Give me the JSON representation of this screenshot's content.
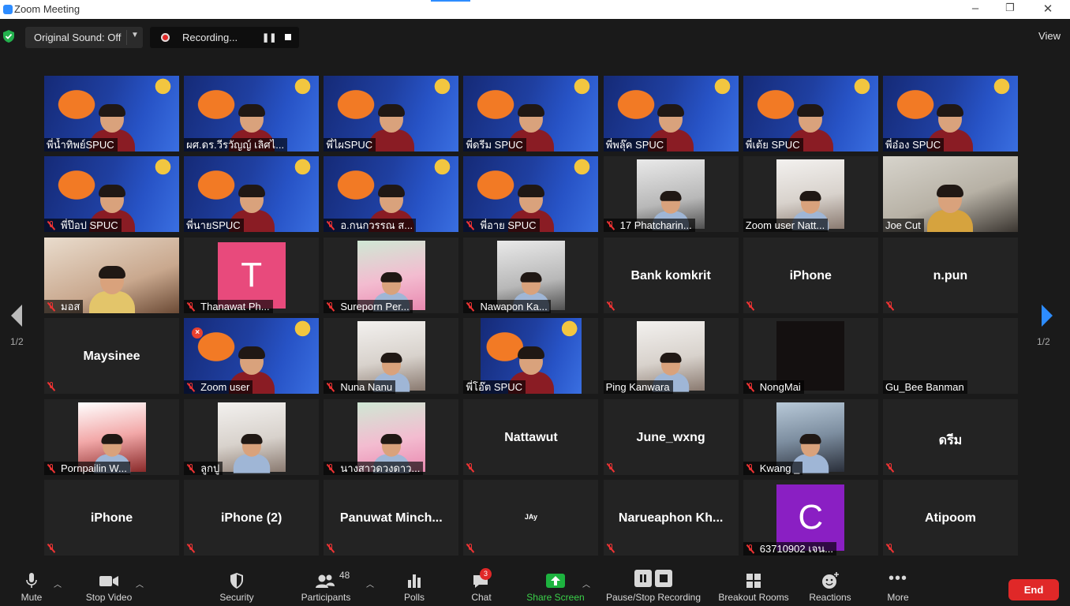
{
  "window": {
    "title": "Zoom Meeting"
  },
  "topbar": {
    "original_sound": "Original Sound: Off",
    "recording_label": "Recording...",
    "view_label": "View"
  },
  "pager": {
    "left_label": "1/2",
    "right_label": "1/2"
  },
  "colors": {
    "accent": "#2d8cff",
    "end_button": "#e02828",
    "share_green": "#3bd24a",
    "active_speaker": "#cfe86a"
  },
  "participants": [
    {
      "name": "พี่น้ำทิพย์SPUC",
      "kind": "banner",
      "muted": false,
      "speaking": true
    },
    {
      "name": "ผศ.ดร.วีรวัญญ์ เลิศไ...",
      "kind": "banner",
      "muted": false
    },
    {
      "name": "พี่ไผSPUC",
      "kind": "banner",
      "muted": false
    },
    {
      "name": "พี่ดรีม SPUC",
      "kind": "banner",
      "muted": false,
      "speaking": true
    },
    {
      "name": "พี่พลุ๊ค SPUC",
      "kind": "banner",
      "muted": false
    },
    {
      "name": "พี่เต้ย SPUC",
      "kind": "banner",
      "muted": false,
      "active": true
    },
    {
      "name": "พี่อ๋อง SPUC",
      "kind": "banner",
      "muted": false
    },
    {
      "name": "พี่ป๊อป SPUC",
      "kind": "banner",
      "muted": true
    },
    {
      "name": "พี่นายSPUC",
      "kind": "banner",
      "muted": false
    },
    {
      "name": "อ.กนกวรรณ ส...",
      "kind": "banner",
      "muted": true
    },
    {
      "name": "พี่อาย SPUC",
      "kind": "banner",
      "muted": true
    },
    {
      "name": "17 Phatcharin...",
      "kind": "photo-gray",
      "muted": true
    },
    {
      "name": "Zoom user Natt...",
      "kind": "photo-light",
      "muted": false
    },
    {
      "name": "Joe Cut",
      "kind": "indoor-full",
      "muted": false
    },
    {
      "name": "มอส",
      "kind": "indoor-full",
      "muted": true
    },
    {
      "name": "Thanawat Ph...",
      "kind": "letter",
      "letter": "T",
      "color": "#e84a7c",
      "muted": true
    },
    {
      "name": "Sureporn Per...",
      "kind": "photo-pink",
      "muted": true
    },
    {
      "name": "Nawapon Ka...",
      "kind": "photo-gray",
      "muted": true
    },
    {
      "name": "Bank komkrit",
      "kind": "text",
      "muted": true
    },
    {
      "name": "iPhone",
      "kind": "text",
      "muted": true
    },
    {
      "name": "n.pun",
      "kind": "text",
      "muted": true
    },
    {
      "name": "Maysinee",
      "kind": "text",
      "muted": true
    },
    {
      "name": "Zoom user",
      "kind": "banner",
      "muted": true,
      "x_mark": true
    },
    {
      "name": "Nuna Nanu",
      "kind": "photo-light",
      "muted": true
    },
    {
      "name": "พี่โอ๊ต SPUC",
      "kind": "banner-inset",
      "muted": false
    },
    {
      "name": "Ping Kanwara",
      "kind": "photo-light",
      "muted": false
    },
    {
      "name": "NongMai",
      "kind": "photo-dark",
      "muted": true
    },
    {
      "name": "Gu_Bee Banman",
      "kind": "blank",
      "muted": false
    },
    {
      "name": "Pornpailin W...",
      "kind": "photo-red",
      "muted": true
    },
    {
      "name": "ลูกปู",
      "kind": "photo-light",
      "muted": true
    },
    {
      "name": "นางสาวดวงดาว...",
      "kind": "photo-pink",
      "muted": true
    },
    {
      "name": "Nattawut",
      "kind": "text",
      "muted": true
    },
    {
      "name": "June_wxng",
      "kind": "text",
      "muted": true
    },
    {
      "name": "Kwang _",
      "kind": "photo-street",
      "muted": true
    },
    {
      "name": "ดรีม",
      "kind": "text",
      "muted": true
    },
    {
      "name": "iPhone",
      "kind": "text",
      "muted": true
    },
    {
      "name": "iPhone (2)",
      "kind": "text",
      "muted": true
    },
    {
      "name": "Panuwat  Minch...",
      "kind": "text",
      "muted": true
    },
    {
      "name": "JAy",
      "kind": "text-small",
      "muted": true
    },
    {
      "name": "Narueaphon  Kh...",
      "kind": "text",
      "muted": true
    },
    {
      "name": "63710902 เจน...",
      "kind": "letter",
      "letter": "C",
      "color": "#8a1fc3",
      "muted": true
    },
    {
      "name": "Atipoom",
      "kind": "text",
      "muted": true
    }
  ],
  "toolbar": {
    "mute": "Mute",
    "stop_video": "Stop Video",
    "security": "Security",
    "participants": "Participants",
    "participants_count": "48",
    "polls": "Polls",
    "chat": "Chat",
    "chat_badge": "3",
    "share_screen": "Share Screen",
    "pause_stop_recording": "Pause/Stop Recording",
    "breakout_rooms": "Breakout Rooms",
    "reactions": "Reactions",
    "more": "More",
    "end": "End"
  }
}
